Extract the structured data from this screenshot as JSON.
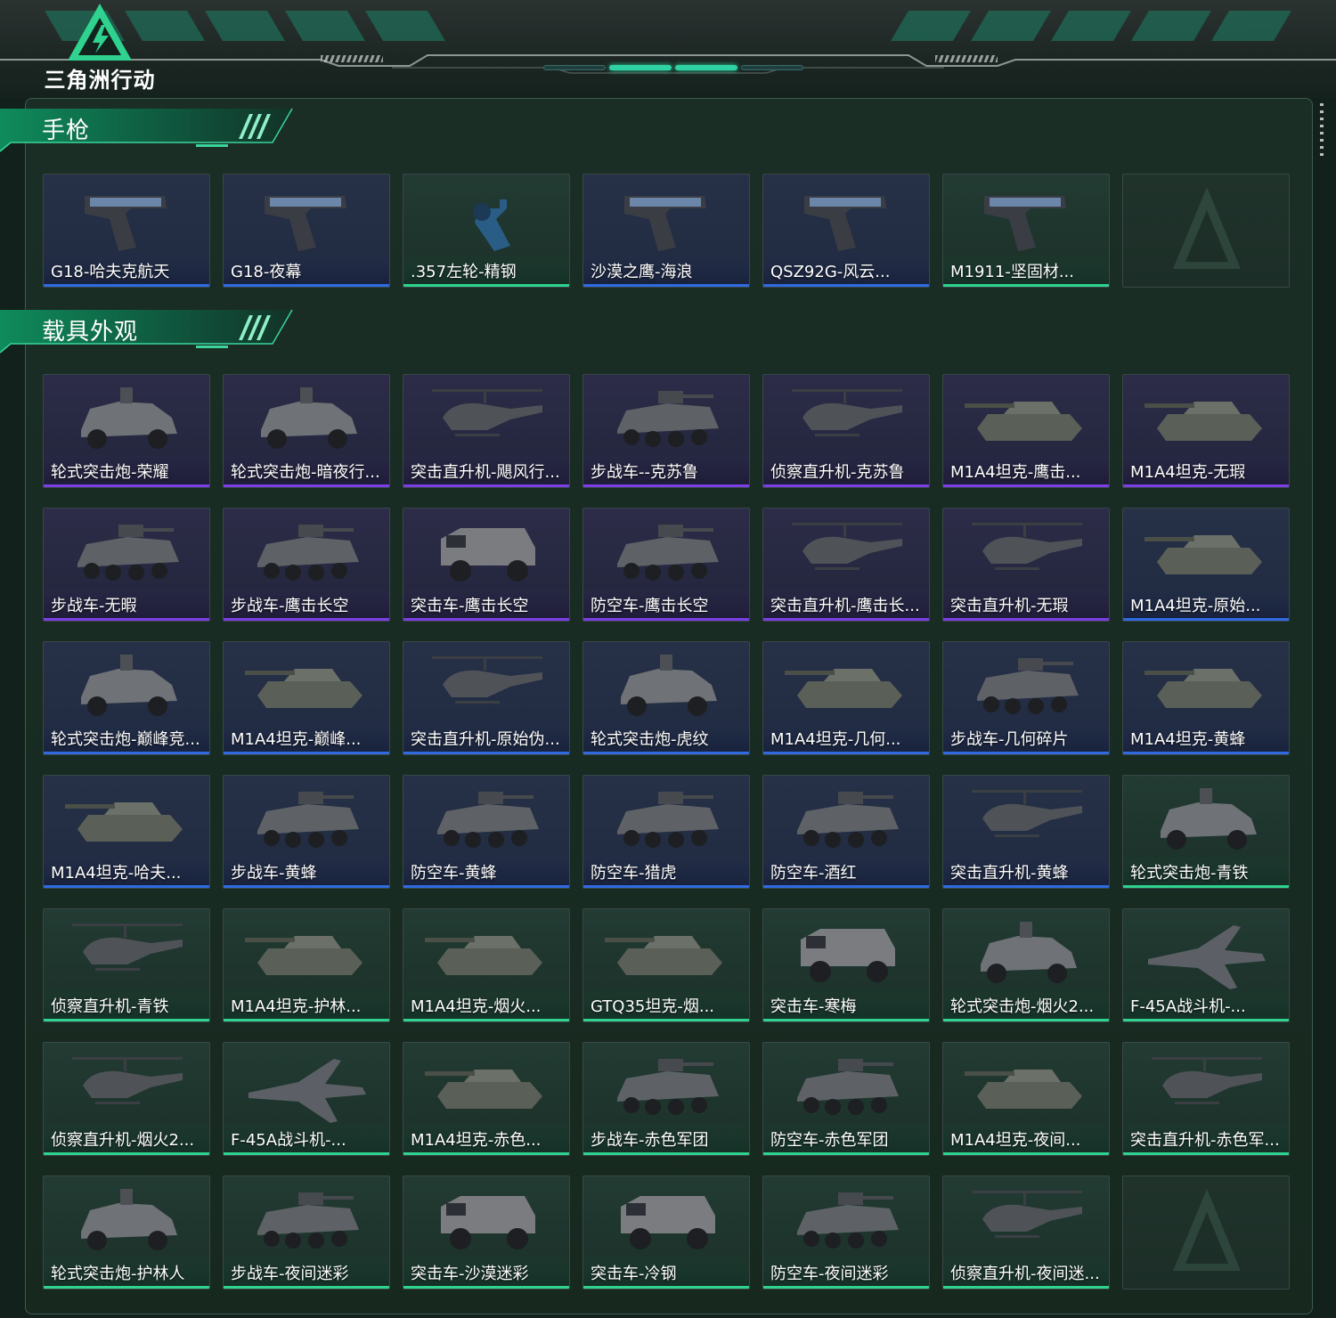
{
  "header": {
    "logo_text": "三角洲行动",
    "accent_color": "#2fd3a3"
  },
  "sections": [
    {
      "title": "手枪",
      "items": [
        {
          "label": "G18-哈夫克航天",
          "rarity": "blue",
          "icon": "pistol"
        },
        {
          "label": "G18-夜幕",
          "rarity": "blue",
          "icon": "pistol"
        },
        {
          "label": ".357左轮-精钢",
          "rarity": "green",
          "icon": "revolver"
        },
        {
          "label": "沙漠之鹰-海浪",
          "rarity": "blue",
          "icon": "pistol"
        },
        {
          "label": "QSZ92G-风云...",
          "rarity": "blue",
          "icon": "pistol"
        },
        {
          "label": "M1911-坚固材...",
          "rarity": "green",
          "icon": "pistol"
        },
        {
          "label": "",
          "rarity": "empty",
          "icon": "placeholder"
        }
      ]
    },
    {
      "title": "载具外观",
      "items": [
        {
          "label": "轮式突击炮-荣耀",
          "rarity": "purple",
          "icon": "armored-car"
        },
        {
          "label": "轮式突击炮-暗夜行...",
          "rarity": "purple",
          "icon": "armored-car"
        },
        {
          "label": "突击直升机-飓风行...",
          "rarity": "purple",
          "icon": "helicopter"
        },
        {
          "label": "步战车--克苏鲁",
          "rarity": "purple",
          "icon": "ifv"
        },
        {
          "label": "侦察直升机-克苏鲁",
          "rarity": "purple",
          "icon": "helicopter"
        },
        {
          "label": "M1A4坦克-鹰击...",
          "rarity": "purple",
          "icon": "tank"
        },
        {
          "label": "M1A4坦克-无瑕",
          "rarity": "purple",
          "icon": "tank"
        },
        {
          "label": "步战车-无暇",
          "rarity": "purple",
          "icon": "ifv"
        },
        {
          "label": "步战车-鹰击长空",
          "rarity": "purple",
          "icon": "ifv"
        },
        {
          "label": "突击车-鹰击长空",
          "rarity": "purple",
          "icon": "truck"
        },
        {
          "label": "防空车-鹰击长空",
          "rarity": "purple",
          "icon": "ifv"
        },
        {
          "label": "突击直升机-鹰击长...",
          "rarity": "purple",
          "icon": "helicopter"
        },
        {
          "label": "突击直升机-无瑕",
          "rarity": "purple",
          "icon": "helicopter"
        },
        {
          "label": "M1A4坦克-原始...",
          "rarity": "blue",
          "icon": "tank"
        },
        {
          "label": "轮式突击炮-巅峰竞...",
          "rarity": "blue",
          "icon": "armored-car"
        },
        {
          "label": "M1A4坦克-巅峰...",
          "rarity": "blue",
          "icon": "tank"
        },
        {
          "label": "突击直升机-原始伪...",
          "rarity": "blue",
          "icon": "helicopter"
        },
        {
          "label": "轮式突击炮-虎纹",
          "rarity": "blue",
          "icon": "armored-car"
        },
        {
          "label": "M1A4坦克-几何...",
          "rarity": "blue",
          "icon": "tank"
        },
        {
          "label": "步战车-几何碎片",
          "rarity": "blue",
          "icon": "ifv"
        },
        {
          "label": "M1A4坦克-黄蜂",
          "rarity": "blue",
          "icon": "tank"
        },
        {
          "label": "M1A4坦克-哈夫...",
          "rarity": "blue",
          "icon": "tank"
        },
        {
          "label": "步战车-黄蜂",
          "rarity": "blue",
          "icon": "ifv"
        },
        {
          "label": "防空车-黄蜂",
          "rarity": "blue",
          "icon": "ifv"
        },
        {
          "label": "防空车-猎虎",
          "rarity": "blue",
          "icon": "ifv"
        },
        {
          "label": "防空车-酒红",
          "rarity": "blue",
          "icon": "ifv"
        },
        {
          "label": "突击直升机-黄蜂",
          "rarity": "blue",
          "icon": "helicopter"
        },
        {
          "label": "轮式突击炮-青铁",
          "rarity": "green",
          "icon": "armored-car"
        },
        {
          "label": "侦察直升机-青铁",
          "rarity": "green",
          "icon": "helicopter"
        },
        {
          "label": "M1A4坦克-护林...",
          "rarity": "green",
          "icon": "tank"
        },
        {
          "label": "M1A4坦克-烟火...",
          "rarity": "green",
          "icon": "tank"
        },
        {
          "label": "GTQ35坦克-烟...",
          "rarity": "green",
          "icon": "tank"
        },
        {
          "label": "突击车-寒梅",
          "rarity": "green",
          "icon": "truck"
        },
        {
          "label": "轮式突击炮-烟火2...",
          "rarity": "green",
          "icon": "armored-car"
        },
        {
          "label": "F-45A战斗机-...",
          "rarity": "green",
          "icon": "jet"
        },
        {
          "label": "侦察直升机-烟火2...",
          "rarity": "green",
          "icon": "helicopter"
        },
        {
          "label": "F-45A战斗机-...",
          "rarity": "green",
          "icon": "jet"
        },
        {
          "label": "M1A4坦克-赤色...",
          "rarity": "green",
          "icon": "tank"
        },
        {
          "label": "步战车-赤色军团",
          "rarity": "green",
          "icon": "ifv"
        },
        {
          "label": "防空车-赤色军团",
          "rarity": "green",
          "icon": "ifv"
        },
        {
          "label": "M1A4坦克-夜间...",
          "rarity": "green",
          "icon": "tank"
        },
        {
          "label": "突击直升机-赤色军...",
          "rarity": "green",
          "icon": "helicopter"
        },
        {
          "label": "轮式突击炮-护林人",
          "rarity": "green",
          "icon": "armored-car"
        },
        {
          "label": "步战车-夜间迷彩",
          "rarity": "green",
          "icon": "ifv"
        },
        {
          "label": "突击车-沙漠迷彩",
          "rarity": "green",
          "icon": "truck"
        },
        {
          "label": "突击车-冷钢",
          "rarity": "green",
          "icon": "truck"
        },
        {
          "label": "防空车-夜间迷彩",
          "rarity": "green",
          "icon": "ifv"
        },
        {
          "label": "侦察直升机-夜间迷...",
          "rarity": "green",
          "icon": "helicopter"
        },
        {
          "label": "",
          "rarity": "empty",
          "icon": "placeholder"
        }
      ]
    }
  ],
  "rarity_colors": {
    "purple": "#7b3fe4",
    "blue": "#2f6ae0",
    "green": "#2fd38f"
  }
}
